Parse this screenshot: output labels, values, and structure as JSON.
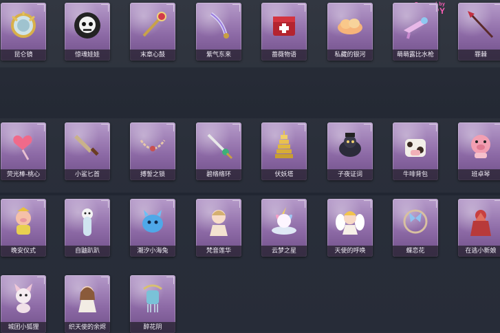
{
  "watermark": {
    "top": "Powered by",
    "main": "LOOPY"
  },
  "items": [
    {
      "name": "昆仑镜",
      "icon": "mirror-icon"
    },
    {
      "name": "惊魂娃娃",
      "icon": "skull-doll-icon"
    },
    {
      "name": "末章心鼓",
      "icon": "scepter-icon"
    },
    {
      "name": "紫气东来",
      "icon": "sword-icon"
    },
    {
      "name": "蔷薇物语",
      "icon": "chest-icon"
    },
    {
      "name": "私藏的银河",
      "icon": "cloud-icon"
    },
    {
      "name": "萌萌露比水枪",
      "icon": "water-gun-icon"
    },
    {
      "name": "罪棘",
      "icon": "spear-icon"
    },
    {
      "name": "荧光棒-桃心",
      "icon": "heart-wand-icon"
    },
    {
      "name": "小鲨匕首",
      "icon": "dagger-icon"
    },
    {
      "name": "搏誓之锁",
      "icon": "chain-icon"
    },
    {
      "name": "碧络络环",
      "icon": "blade-icon"
    },
    {
      "name": "伏妖塔",
      "icon": "pagoda-icon"
    },
    {
      "name": "子夜证词",
      "icon": "crow-icon"
    },
    {
      "name": "牛啡背包",
      "icon": "cow-backpack-icon"
    },
    {
      "name": "班卓琴",
      "icon": "pig-toy-icon"
    },
    {
      "name": "晚安仪式",
      "icon": "pig-figure-icon"
    },
    {
      "name": "自鼬趴趴",
      "icon": "weasel-icon"
    },
    {
      "name": "潮汐小海兔",
      "icon": "sea-bunny-icon"
    },
    {
      "name": "梵音莲华",
      "icon": "doll-icon"
    },
    {
      "name": "云梦之星",
      "icon": "unicorn-icon"
    },
    {
      "name": "天使的呼唤",
      "icon": "angel-icon"
    },
    {
      "name": "蝶恋花",
      "icon": "butterfly-ring-icon"
    },
    {
      "name": "在逃小新娘",
      "icon": "bride-icon"
    },
    {
      "name": "城团小狐狸",
      "icon": "fox-icon"
    },
    {
      "name": "织天使的余烬",
      "icon": "angel-girl-icon"
    },
    {
      "name": "醉花阴",
      "icon": "lantern-icon"
    }
  ]
}
